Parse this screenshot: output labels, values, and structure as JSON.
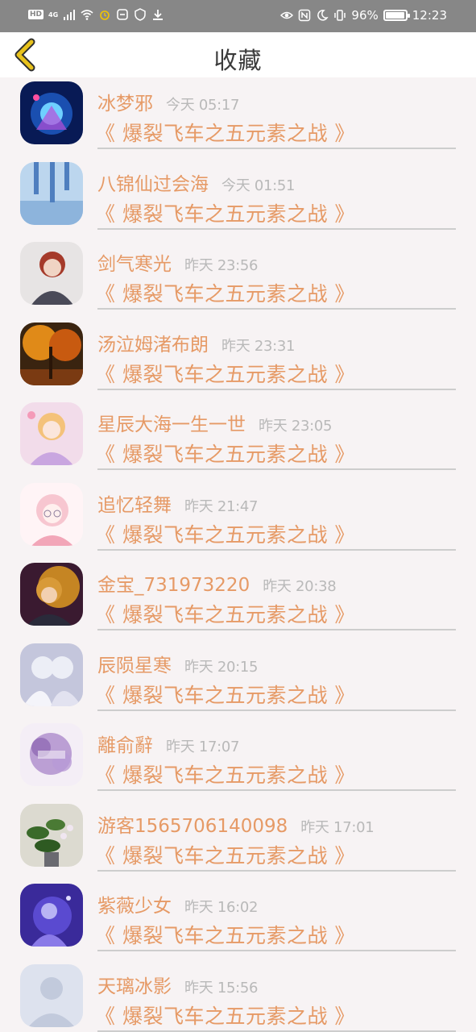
{
  "status_bar": {
    "hd_label": "HD",
    "network_label": "4G",
    "battery_text": "96%",
    "battery_level": 0.96,
    "time": "12:23"
  },
  "header": {
    "title": "收藏",
    "back_icon": "chevron-left-icon",
    "back_color": "#e8c21c"
  },
  "favorites": [
    {
      "name": "冰梦邪",
      "time": "今天 05:17",
      "novel": "《 爆裂飞车之五元素之战 》"
    },
    {
      "name": "八锦仙过会海",
      "time": "今天 01:51",
      "novel": "《 爆裂飞车之五元素之战 》"
    },
    {
      "name": "剑气寒光",
      "time": "昨天 23:56",
      "novel": "《 爆裂飞车之五元素之战 》"
    },
    {
      "name": "汤泣姆渚布朗",
      "time": "昨天 23:31",
      "novel": "《 爆裂飞车之五元素之战 》"
    },
    {
      "name": "星辰大海一生一世",
      "time": "昨天 23:05",
      "novel": "《 爆裂飞车之五元素之战 》"
    },
    {
      "name": "追忆轻舞",
      "time": "昨天 21:47",
      "novel": "《 爆裂飞车之五元素之战 》"
    },
    {
      "name": "金宝_731973220",
      "time": "昨天 20:38",
      "novel": "《 爆裂飞车之五元素之战 》"
    },
    {
      "name": "辰陨星寒",
      "time": "昨天 20:15",
      "novel": "《 爆裂飞车之五元素之战 》"
    },
    {
      "name": "離俞辭",
      "time": "昨天 17:07",
      "novel": "《 爆裂飞车之五元素之战 》"
    },
    {
      "name": "游客1565706140098",
      "time": "昨天 17:01",
      "novel": "《 爆裂飞车之五元素之战 》"
    },
    {
      "name": "紫薇少女",
      "time": "昨天 16:02",
      "novel": "《 爆裂飞车之五元素之战 》"
    },
    {
      "name": "天璃冰影",
      "time": "昨天 15:56",
      "novel": "《 爆裂飞车之五元素之战 》"
    }
  ],
  "colors": {
    "accent": "#e69a66",
    "timestamp": "#b9b9b9",
    "status_bar": "#878787",
    "background": "#f7f3f4"
  }
}
